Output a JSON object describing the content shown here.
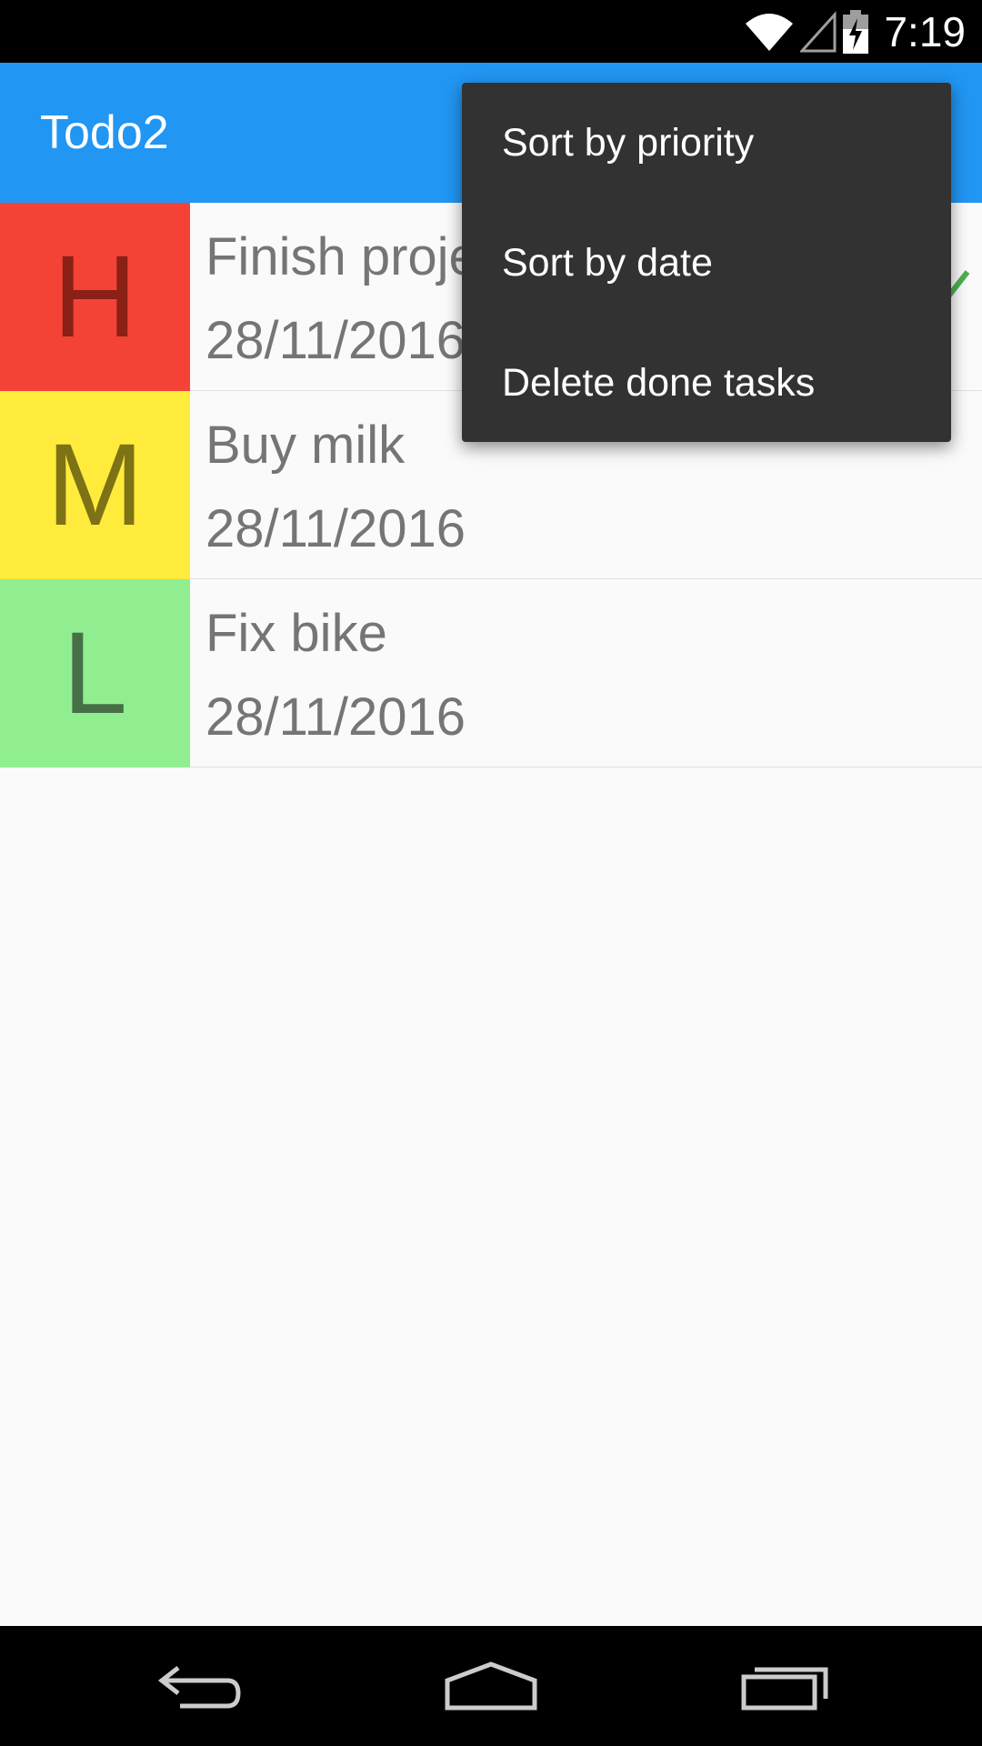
{
  "status_bar": {
    "time": "7:19",
    "icons": [
      "wifi-icon",
      "cell-signal-icon",
      "battery-charging-icon"
    ]
  },
  "app_bar": {
    "title": "Todo2",
    "color": "#2196f3"
  },
  "tasks": [
    {
      "priority": "H",
      "priority_color": "#f44336",
      "priority_text_color": "#8b2017",
      "title": "Finish project",
      "date": "28/11/2016",
      "done": true
    },
    {
      "priority": "M",
      "priority_color": "#ffeb3b",
      "priority_text_color": "#7d7216",
      "title": "Buy milk",
      "date": "28/11/2016",
      "done": false
    },
    {
      "priority": "L",
      "priority_color": "#90ee90",
      "priority_text_color": "#476f47",
      "title": "Fix bike",
      "date": "28/11/2016",
      "done": false
    }
  ],
  "overflow_menu": {
    "items": [
      {
        "label": "Sort by priority"
      },
      {
        "label": "Sort by date"
      },
      {
        "label": "Delete done tasks"
      }
    ]
  },
  "nav_bar": {
    "icons": [
      "back-icon",
      "home-icon",
      "recent-apps-icon"
    ]
  }
}
